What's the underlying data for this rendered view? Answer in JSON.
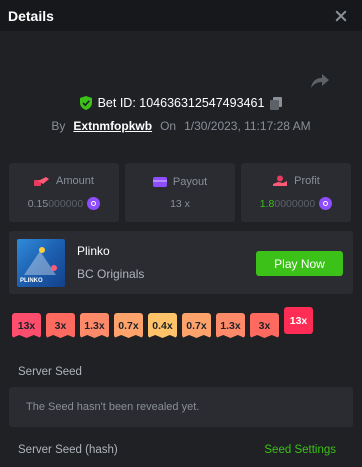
{
  "header": {
    "title": "Details"
  },
  "bet": {
    "id_label": "Bet ID: 104636312547493461",
    "by": "By",
    "username": "Extnmfopkwb",
    "on": "On",
    "datetime": "1/30/2023, 11:17:28 AM"
  },
  "stats": {
    "amount": {
      "label": "Amount",
      "value_main": "0.15",
      "value_zeros": "000000"
    },
    "payout": {
      "label": "Payout",
      "value": "13 x"
    },
    "profit": {
      "label": "Profit",
      "value_main": "1.8",
      "value_zeros": "0000000"
    }
  },
  "game": {
    "name": "Plinko",
    "provider": "BC Originals",
    "play_label": "Play Now",
    "thumb_text": "PLINKO"
  },
  "multipliers": [
    {
      "label": "13x",
      "color": "#ff4d6d",
      "active": false
    },
    {
      "label": "3x",
      "color": "#ff6a60",
      "active": false
    },
    {
      "label": "1.3x",
      "color": "#ff8a6a",
      "active": false
    },
    {
      "label": "0.7x",
      "color": "#ffa36c",
      "active": false
    },
    {
      "label": "0.4x",
      "color": "#ffc46a",
      "active": false
    },
    {
      "label": "0.7x",
      "color": "#ffa36c",
      "active": false
    },
    {
      "label": "1.3x",
      "color": "#ff8a6a",
      "active": false
    },
    {
      "label": "3x",
      "color": "#ff6a60",
      "active": false
    },
    {
      "label": "13x",
      "color": "#ff2d55",
      "active": true
    }
  ],
  "server_seed": {
    "label": "Server Seed",
    "value": "The Seed hasn't been revealed yet."
  },
  "server_seed_hash": {
    "label": "Server Seed (hash)",
    "settings_label": "Seed Settings"
  },
  "colors": {
    "accent": "#3bc117",
    "coin": "#8e4dff",
    "panel": "#2a2c31",
    "background": "#1f2125"
  }
}
